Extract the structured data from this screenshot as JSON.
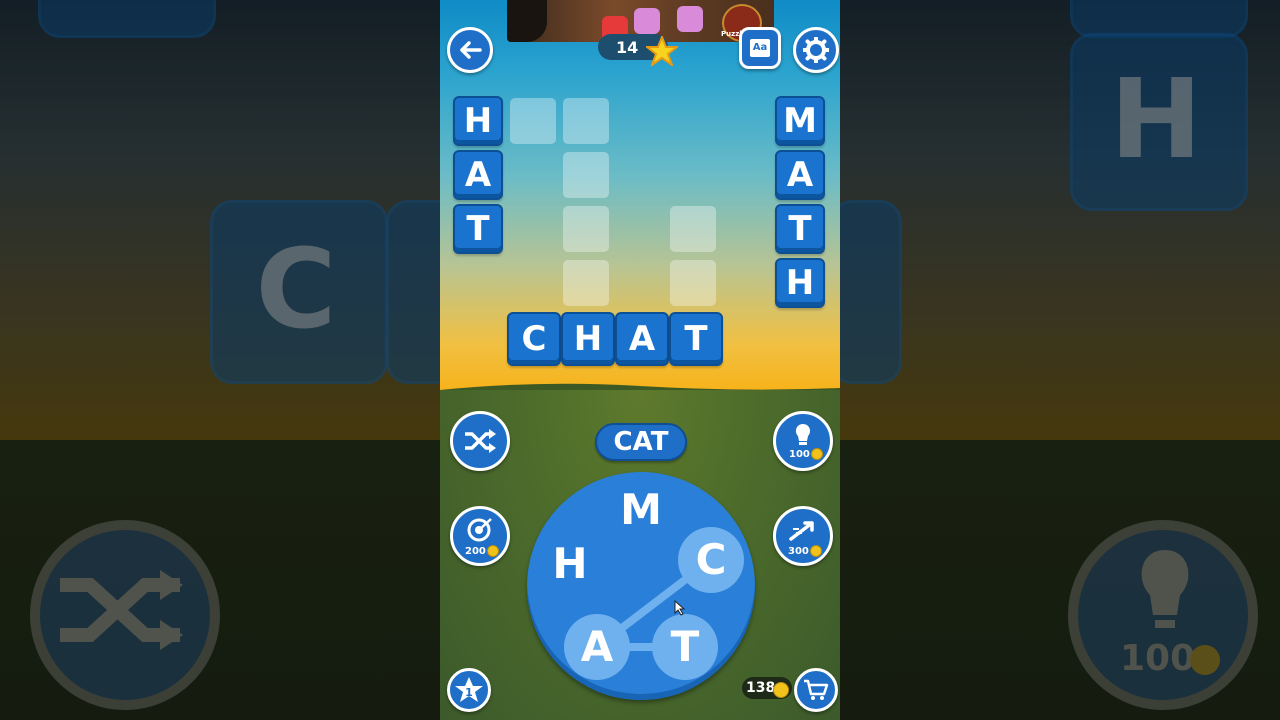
{
  "ad": {
    "brand_text": "Puzzle"
  },
  "header": {
    "back_icon": "arrow-left-icon",
    "score": "14",
    "dictionary_label": "Aa",
    "settings_icon": "gear-icon"
  },
  "board": {
    "words_found": [
      "HAT",
      "MATH",
      "CHAT"
    ],
    "tiles": {
      "hat": [
        "H",
        "A",
        "T"
      ],
      "math": [
        "M",
        "A",
        "T",
        "H"
      ],
      "chat": [
        "C",
        "H",
        "A",
        "T"
      ]
    }
  },
  "current_word": "CAT",
  "wheel": {
    "letters": [
      "M",
      "H",
      "C",
      "A",
      "T"
    ],
    "selected": [
      "C",
      "A",
      "T"
    ]
  },
  "boosters": {
    "shuffle_icon": "shuffle-icon",
    "hint_cost": "100",
    "target_cost": "200",
    "rocket_cost": "300",
    "star_level": "1"
  },
  "coins": "138",
  "colors": {
    "tile": "#1a73cf",
    "wheel": "#2a7fd8",
    "selected": "#6fb1ee"
  }
}
